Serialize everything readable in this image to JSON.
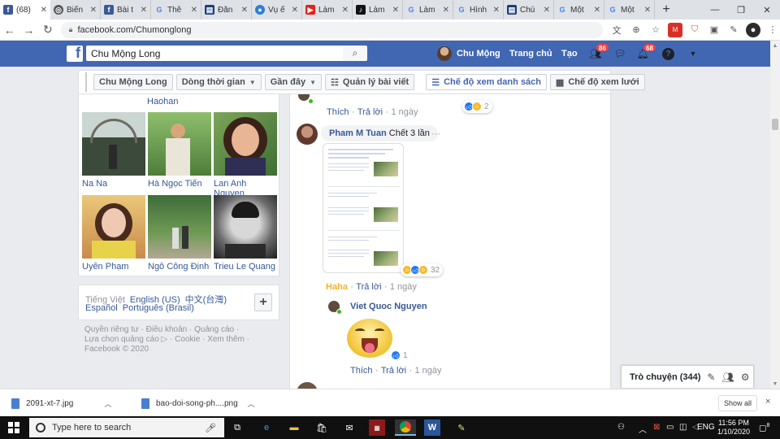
{
  "browser": {
    "tabs": [
      {
        "title": "(68)",
        "favicon": "facebook-icon",
        "color": "#3b5998",
        "active": true
      },
      {
        "title": "Biến",
        "favicon": "globe-icon",
        "color": "#555555"
      },
      {
        "title": "Bài t",
        "favicon": "facebook-icon",
        "color": "#3b5998"
      },
      {
        "title": "Thê",
        "favicon": "google-icon",
        "color": "#4285f4"
      },
      {
        "title": "Đăn",
        "favicon": "news-icon",
        "color": "#1a3d7c"
      },
      {
        "title": "Vụ ế",
        "favicon": "news-circle-icon",
        "color": "#2d7fd4"
      },
      {
        "title": "Làm",
        "favicon": "youtube-icon",
        "color": "#e62117"
      },
      {
        "title": "Làm",
        "favicon": "tiktok-icon",
        "color": "#111111"
      },
      {
        "title": "Làm",
        "favicon": "google-icon",
        "color": "#4285f4"
      },
      {
        "title": "Hình",
        "favicon": "google-icon",
        "color": "#4285f4"
      },
      {
        "title": "Chú",
        "favicon": "news-icon",
        "color": "#1a3d7c"
      },
      {
        "title": "Một",
        "favicon": "google-icon",
        "color": "#4285f4"
      },
      {
        "title": "Một",
        "favicon": "google-icon",
        "color": "#4285f4"
      }
    ],
    "new_tab": "+",
    "url": "facebook.com/Chumonglong"
  },
  "fb_header": {
    "search_value": "Chu Mộng Long",
    "user_name": "Chu Mộng",
    "home": "Trang chủ",
    "create": "Tạo",
    "friend_badge": "86",
    "notif_badge": "68",
    "brand_color": "#4267b2"
  },
  "profile_toolbar": {
    "name": "Chu Mộng Long",
    "timeline": "Dòng thời gian",
    "sort": "Gần đây",
    "manage_posts": "Quản lý bài viết",
    "list_view": "Chế độ xem danh sách",
    "grid_view": "Chế độ xem lưới"
  },
  "friends": {
    "top_partial": "Haohan",
    "items": [
      {
        "name": "Na Na"
      },
      {
        "name": "Hà Ngọc Tiến"
      },
      {
        "name": "Lan Anh Nguyen"
      },
      {
        "name": "Uyên Phạm"
      },
      {
        "name": "Ngô Công Định"
      },
      {
        "name": "Trieu Le Quang"
      }
    ]
  },
  "languages": {
    "current": "Tiếng Việt",
    "line1": [
      "English (US)",
      "中文(台灣)"
    ],
    "line2": [
      "Español",
      "Português (Brasil)"
    ],
    "add": "+"
  },
  "footer": {
    "line1": [
      "Quyền riêng tư",
      "·",
      "Điều khoản",
      "·",
      "Quảng cáo",
      "·"
    ],
    "line2": [
      "Lựa chọn quảng cáo ▷",
      "·",
      "Cookie",
      "·",
      "Xem thêm",
      "·"
    ],
    "line3": "Facebook © 2020"
  },
  "comments": {
    "top": {
      "like": "Thích",
      "reply": "Trả lời",
      "time": "1 ngày",
      "react_count": "2"
    },
    "c1": {
      "author": "Pham M Tuan",
      "text": "Chết 3 lần",
      "more": "···",
      "react_label": "Haha",
      "reply": "Trả lời",
      "time": "1 ngày",
      "react_count": "32"
    },
    "c2": {
      "author": "Viet Quoc Nguyen",
      "like": "Thích",
      "reply": "Trả lời",
      "time": "1 ngày",
      "react_count": "1"
    },
    "sep": "·"
  },
  "chat": {
    "label": "Trò chuyện (344)"
  },
  "downloads": {
    "items": [
      "2091-xt-7.jpg",
      "bao-doi-song-ph....png"
    ],
    "show_all": "Show all",
    "close": "×"
  },
  "taskbar": {
    "search_placeholder": "Type here to search",
    "lang": "ENG",
    "time": "11:56 PM",
    "date": "1/10/2020",
    "notif_count": "8"
  }
}
